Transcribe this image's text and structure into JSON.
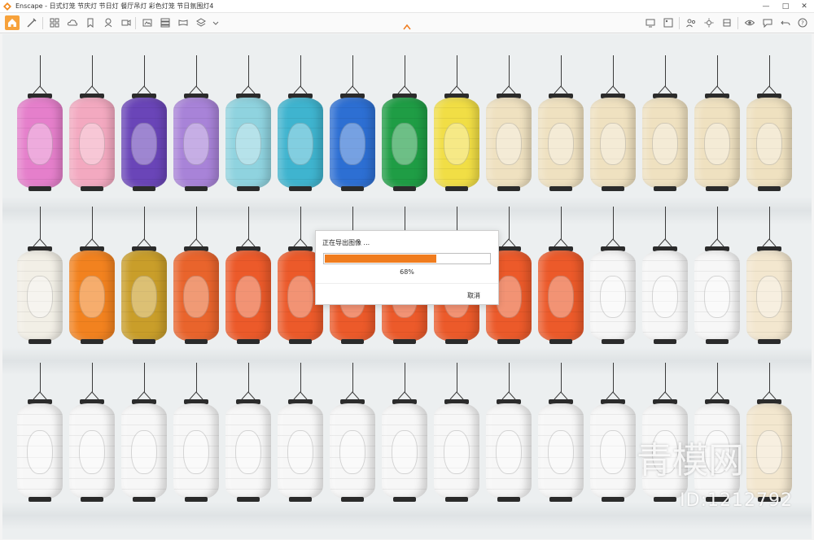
{
  "window": {
    "title": "Enscape - 日式灯笼 节庆灯 节日灯 餐厅吊灯 彩色灯笼 节日氛围灯4"
  },
  "toolbar": {
    "buttons": [
      "home-icon",
      "tools-icon",
      "grid-icon",
      "cloud-icon",
      "bookmark-icon",
      "asset-icon",
      "export-icon",
      "video-icon",
      "layers-icon",
      "panorama-icon",
      "batch-icon",
      "dropdown-icon"
    ],
    "right_buttons": [
      "display-icon",
      "image-icon",
      "collaborate-icon",
      "settings-icon",
      "visibility-icon",
      "feedback-icon",
      "help-icon"
    ]
  },
  "dialog": {
    "title": "正在导出图像 ...",
    "progress": 0.68,
    "progress_text": "68%",
    "cancel_label": "取消"
  },
  "watermark": {
    "logo_text": "青模网",
    "id_text": "ID:1212792"
  },
  "colors": {
    "accent": "#f07c1e",
    "home_button": "#f7a23b",
    "row1": [
      "#e57fcb",
      "#f3a9c0",
      "#6a45b8",
      "#a883d8",
      "#8fd3df",
      "#3fb4cf",
      "#2d6fd3",
      "#1f9d45",
      "#f1de45",
      "#efe1c0",
      "#efe1c0",
      "#efe1c0",
      "#efe1c0",
      "#efe1c0",
      "#efe1c0"
    ],
    "row2": [
      "#f2efe6",
      "#f2821f",
      "#c99e2a",
      "#e9642c",
      "#ec5a2a",
      "#ec5a2a",
      "#ec5a2a",
      "#ec5a2a",
      "#ec5a2a",
      "#ec5a2a",
      "#ec5a2a",
      "#f7f7f7",
      "#f7f7f7",
      "#f7f7f7",
      "#f3e7cf"
    ],
    "row3": [
      "#f7f7f7",
      "#f7f7f7",
      "#f7f7f7",
      "#f7f7f7",
      "#f7f7f7",
      "#f7f7f7",
      "#f7f7f7",
      "#f7f7f7",
      "#f7f7f7",
      "#f7f7f7",
      "#f7f7f7",
      "#f7f7f7",
      "#f7f7f7",
      "#f7f7f7",
      "#f3e7cf"
    ]
  }
}
